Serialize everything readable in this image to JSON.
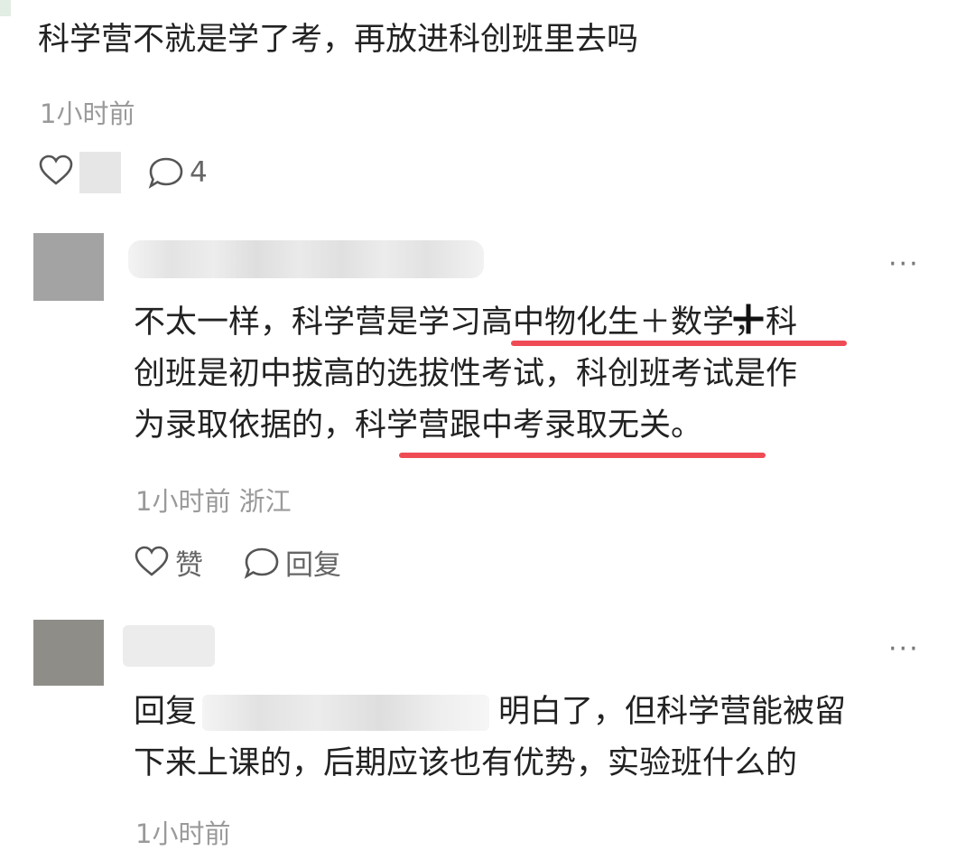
{
  "colors": {
    "accent_underline": "#ef4b55",
    "meta_gray": "#9a9a9a",
    "text": "#222222"
  },
  "post": {
    "text": "科学营不就是学了考，再放进科创班里去吗",
    "time": "1小时前",
    "comment_count": "4"
  },
  "replies": [
    {
      "avatar_color": "#a3a3a3",
      "more_icon": "more-icon",
      "lines": [
        "不太一样，科学营是学习高中物化生＋数学，科",
        "创班是初中拔高的选拔性考试，科创班考试是作",
        "为录取依据的，科学营跟中考录取无关。"
      ],
      "meta": "1小时前 浙江",
      "like_label": "赞",
      "reply_label": "回复"
    },
    {
      "avatar_color": "#8f8d88",
      "more_icon": "more-icon",
      "reply_prefix": "回复",
      "line1_rest": "明白了，但科学营能被留",
      "line2": "下来上课的，后期应该也有优势，实验班什么的",
      "meta": "1小时前"
    }
  ]
}
